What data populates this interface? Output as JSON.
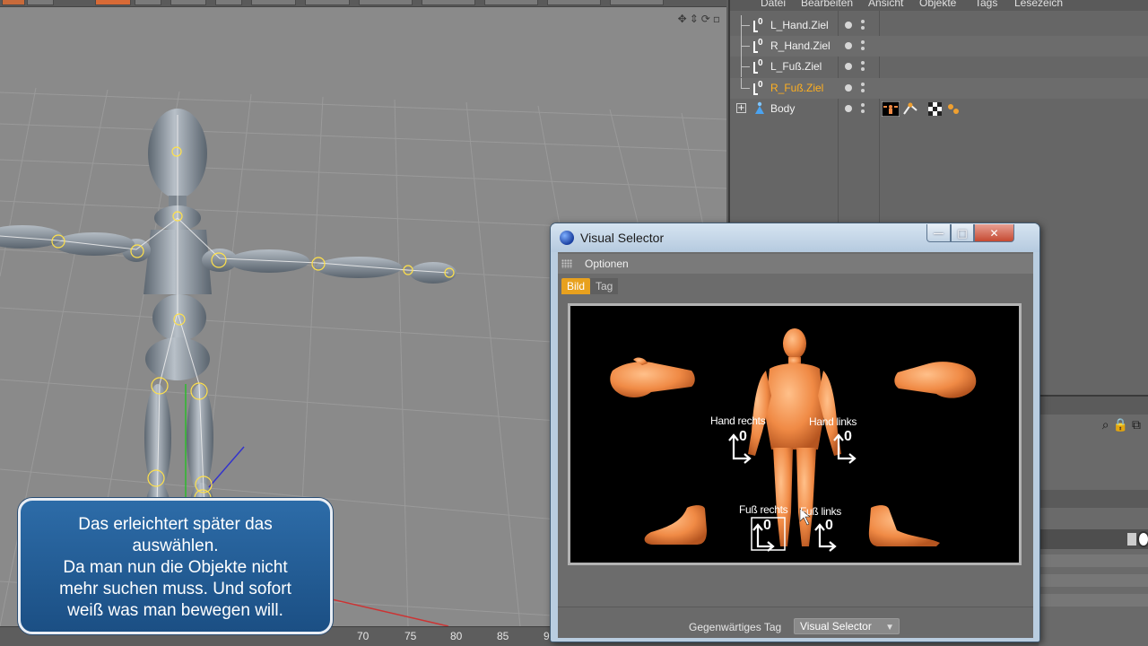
{
  "object_manager": {
    "menu": [
      "Datei",
      "Bearbeiten",
      "Ansicht",
      "Objekte",
      "Tags",
      "Lesezeich"
    ],
    "objects": [
      {
        "name": "L_Hand.Ziel",
        "active": false
      },
      {
        "name": "R_Hand.Ziel",
        "active": false
      },
      {
        "name": "L_Fuß.Ziel",
        "active": false
      },
      {
        "name": "R_Fuß.Ziel",
        "active": true
      },
      {
        "name": "Body",
        "active": false
      }
    ]
  },
  "timeline": {
    "ticks": [
      "70",
      "75",
      "80",
      "85",
      "9"
    ]
  },
  "visual_selector": {
    "title": "Visual Selector",
    "menu_label": "Optionen",
    "tabs": [
      {
        "label": "Bild",
        "active": true
      },
      {
        "label": "Tag",
        "active": false
      }
    ],
    "hotspots": {
      "hand_right": "Hand rechts",
      "hand_left": "Hand links",
      "foot_right": "Fuß rechts",
      "foot_left": "Fuß links",
      "marker_value": "0"
    },
    "footer_label": "Gegenwärtiges Tag",
    "footer_value": "Visual Selector",
    "window_buttons": {
      "minimize": "—",
      "maximize": "□",
      "close": "✕"
    }
  },
  "caption": {
    "lines": [
      "Das erleichtert später das",
      "auswählen.",
      "Da man nun die Objekte nicht",
      "mehr suchen muss. Und sofort",
      "weiß was man bewegen will."
    ]
  },
  "colors": {
    "selection_accent": "#ffb020",
    "tab_active": "#e8a11e",
    "caption_bg": "#1f5b94",
    "skin": "#f08a45"
  }
}
